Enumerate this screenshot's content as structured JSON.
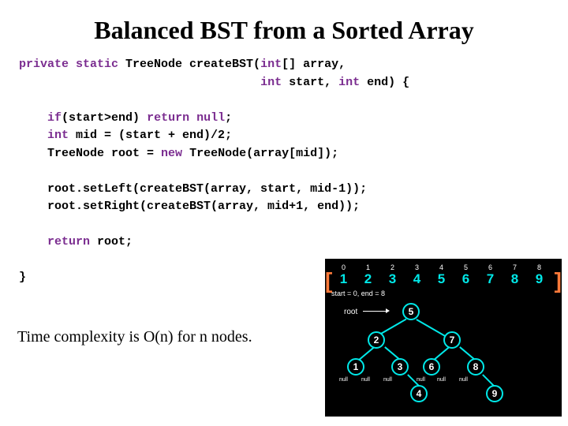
{
  "title": "Balanced BST from a Sorted Array",
  "code": {
    "l1a": "private static",
    "l1b": " TreeNode createBST(",
    "l1c": "int",
    "l1d": "[] array,",
    "l2a": "int",
    "l2b": " start, ",
    "l2c": "int",
    "l2d": " end) {",
    "l3a": "if",
    "l3b": "(start>end) ",
    "l3c": "return null",
    "l3d": ";",
    "l4a": "int",
    "l4b": " mid = (start + end)/2;",
    "l5a": "TreeNode root = ",
    "l5b": "new",
    "l5c": " TreeNode(array[mid]);",
    "l6": "root.setLeft(createBST(array, start, mid-1));",
    "l7": "root.setRight(createBST(array, mid+1, end));",
    "l8a": "return",
    "l8b": " root;",
    "l9": "}"
  },
  "complexity": "Time complexity is O(n) for n nodes.",
  "diagram": {
    "indices": [
      "0",
      "1",
      "2",
      "3",
      "4",
      "5",
      "6",
      "7",
      "8"
    ],
    "values": [
      "1",
      "2",
      "3",
      "4",
      "5",
      "6",
      "7",
      "8",
      "9"
    ],
    "caption": "start = 0, end = 8",
    "root_label": "root",
    "nodes": {
      "n5": "5",
      "n2": "2",
      "n7": "7",
      "n1": "1",
      "n3": "3",
      "n6": "6",
      "n8": "8",
      "n4": "4",
      "n9": "9"
    },
    "null_label": "null"
  }
}
